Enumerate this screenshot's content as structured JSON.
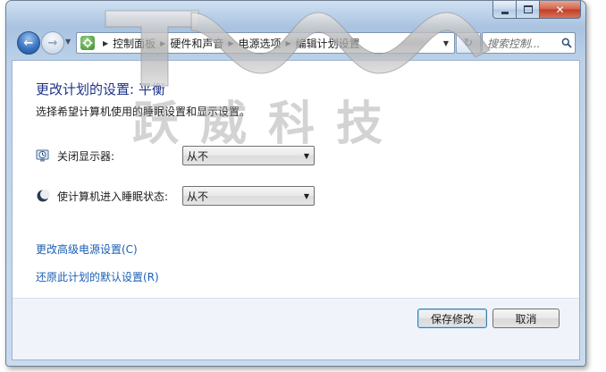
{
  "window": {
    "minimize_icon": "minimize-icon",
    "maximize_icon": "maximize-icon",
    "close_label": "✕"
  },
  "navigation": {
    "back_icon": "back-arrow-icon",
    "forward_icon": "forward-arrow-icon",
    "breadcrumbs": [
      "控制面板",
      "硬件和声音",
      "电源选项",
      "编辑计划设置"
    ],
    "search_placeholder": "搜索控制...",
    "refresh_icon": "refresh-icon",
    "search_icon": "magnifier-icon"
  },
  "page": {
    "title": "更改计划的设置: 平衡",
    "description": "选择希望计算机使用的睡眠设置和显示设置。"
  },
  "settings": {
    "display_off": {
      "label": "关闭显示器:",
      "value": "从不",
      "icon": "monitor-clock-icon"
    },
    "sleep": {
      "label": "使计算机进入睡眠状态:",
      "value": "从不",
      "icon": "moon-icon"
    }
  },
  "links": {
    "advanced": "更改高级电源设置(C)",
    "restore": "还原此计划的默认设置(R)"
  },
  "buttons": {
    "save": "保存修改",
    "cancel": "取消"
  },
  "watermark": {
    "text": "跃威科技"
  },
  "colors": {
    "title": "#1e3287",
    "link": "#1a5fb4",
    "chrome": "#a9c3e0"
  }
}
